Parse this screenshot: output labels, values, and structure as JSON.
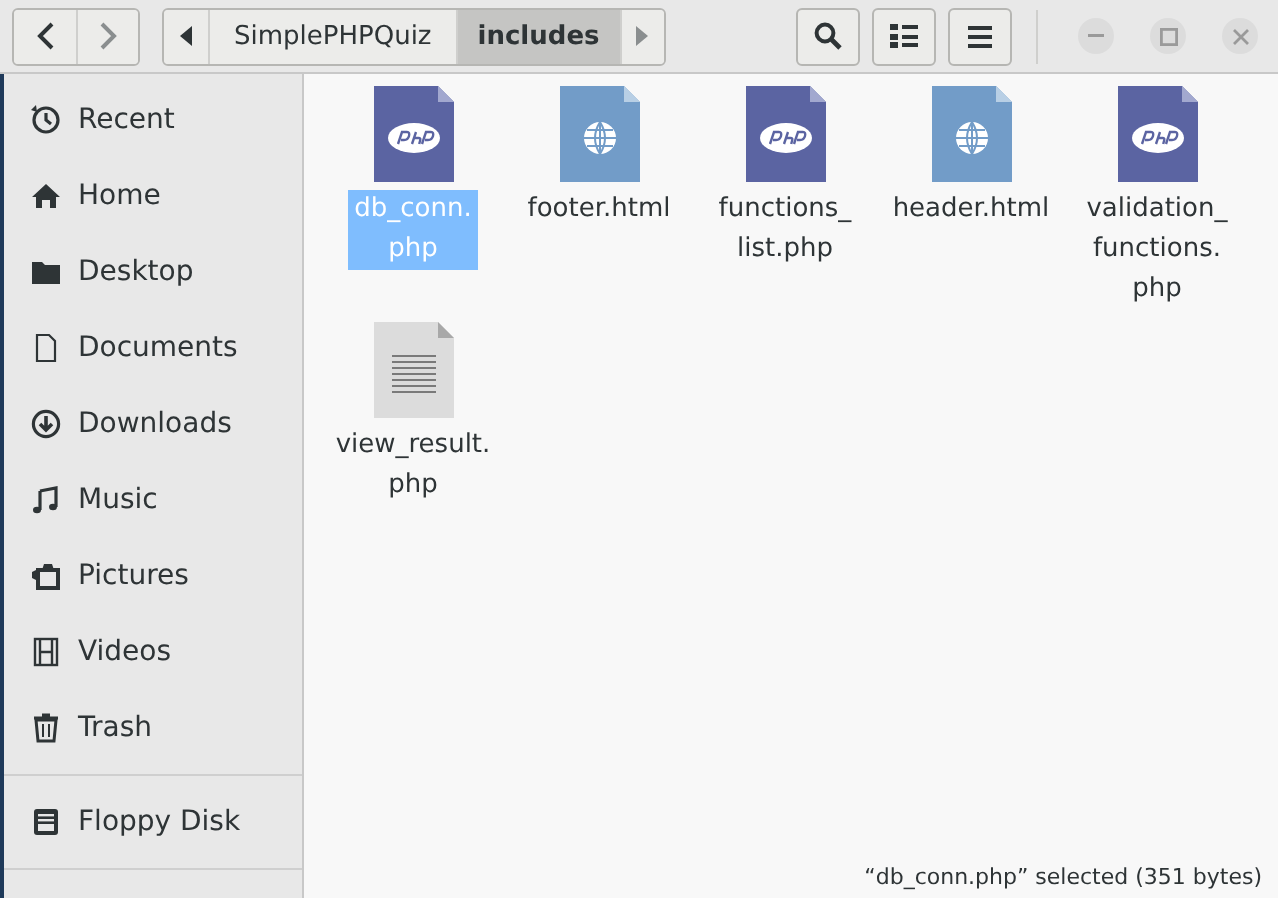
{
  "path_bar": [
    {
      "label": "SimplePHPQuiz",
      "selected": false
    },
    {
      "label": "includes",
      "selected": true
    }
  ],
  "sidebar": {
    "items": [
      {
        "label": "Recent"
      },
      {
        "label": "Home"
      },
      {
        "label": "Desktop"
      },
      {
        "label": "Documents"
      },
      {
        "label": "Downloads"
      },
      {
        "label": "Music"
      },
      {
        "label": "Pictures"
      },
      {
        "label": "Videos"
      },
      {
        "label": "Trash"
      }
    ],
    "devices": [
      {
        "label": "Floppy Disk"
      }
    ]
  },
  "files": [
    {
      "name": "db_conn.\nphp",
      "kind": "php",
      "selected": true
    },
    {
      "name": "footer.html",
      "kind": "html",
      "selected": false
    },
    {
      "name": "functions_\nlist.php",
      "kind": "php",
      "selected": false
    },
    {
      "name": "header.html",
      "kind": "html",
      "selected": false
    },
    {
      "name": "validation_\nfunctions.\nphp",
      "kind": "php",
      "selected": false
    },
    {
      "name": "view_result.\nphp",
      "kind": "text",
      "selected": false
    }
  ],
  "status_bar": "“db_conn.php” selected  (351 bytes)"
}
